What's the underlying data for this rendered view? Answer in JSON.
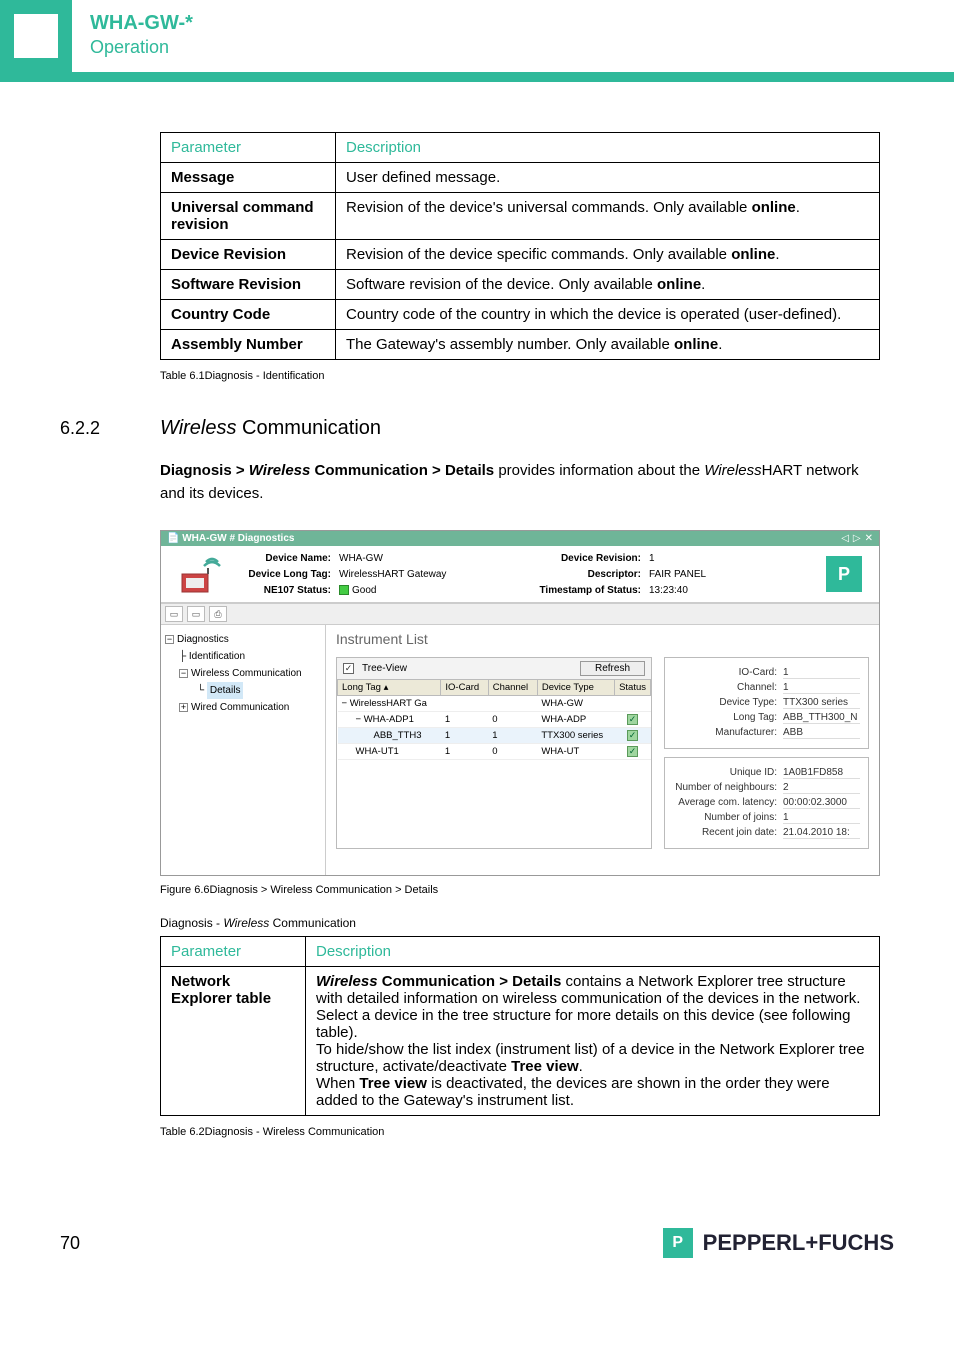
{
  "header": {
    "line1": "WHA-GW-*",
    "line2": "Operation"
  },
  "table1": {
    "head_param": "Parameter",
    "head_desc": "Description",
    "rows": [
      {
        "p": "Message",
        "d": "User defined message."
      },
      {
        "p": "Universal command revision",
        "d_pre": "Revision of the device's universal commands. Only available ",
        "d_bold": "online",
        "d_post": "."
      },
      {
        "p": "Device Revision",
        "d_pre": "Revision of the device specific commands. Only available ",
        "d_bold": "online",
        "d_post": "."
      },
      {
        "p": "Software Revision",
        "d_pre": "Software revision of the device. Only available ",
        "d_bold": "online",
        "d_post": "."
      },
      {
        "p": "Country Code",
        "d": "Country code of the country in which the device is operated (user-defined)."
      },
      {
        "p": "Assembly Number",
        "d_pre": "The Gateway's assembly number. Only available ",
        "d_bold": "online",
        "d_post": "."
      }
    ],
    "caption": "Table 6.1Diagnosis - Identification"
  },
  "section": {
    "num": "6.2.2",
    "title_it": "Wireless",
    "title_rest": " Communication",
    "body_b1": "Diagnosis > ",
    "body_bi": "Wireless",
    "body_b2": " Communication > Details",
    "body_r1": " provides information about the ",
    "body_i2": "Wireless",
    "body_r2": "HART network and its devices."
  },
  "screenshot": {
    "titlebar": "WHA-GW # Diagnostics",
    "hdr": {
      "device_name_lbl": "Device Name:",
      "device_name_val": "WHA-GW",
      "device_long_tag_lbl": "Device Long Tag:",
      "device_long_tag_val": "WirelessHART Gateway",
      "ne107_lbl": "NE107 Status:",
      "ne107_val": "Good",
      "device_rev_lbl": "Device Revision:",
      "device_rev_val": "1",
      "descriptor_lbl": "Descriptor:",
      "descriptor_val": "FAIR PANEL",
      "timestamp_lbl": "Timestamp of Status:",
      "timestamp_val": "13:23:40"
    },
    "tree": {
      "root": "Diagnostics",
      "n1": "Identification",
      "n2": "Wireless Communication",
      "n2a": "Details",
      "n3": "Wired Communication"
    },
    "main_title": "Instrument List",
    "treeview_label": "Tree-View",
    "refresh": "Refresh",
    "grid": {
      "h1": "Long Tag",
      "h2": "IO-Card",
      "h3": "Channel",
      "h4": "Device Type",
      "h5": "Status",
      "r0": {
        "tag": "WirelessHART Ga",
        "io": "",
        "ch": "",
        "dt": "WHA-GW",
        "st": ""
      },
      "r1": {
        "tag": "WHA-ADP1",
        "io": "1",
        "ch": "0",
        "dt": "WHA-ADP"
      },
      "r2": {
        "tag": "ABB_TTH3",
        "io": "1",
        "ch": "1",
        "dt": "TTX300 series"
      },
      "r3": {
        "tag": "WHA-UT1",
        "io": "1",
        "ch": "0",
        "dt": "WHA-UT"
      }
    },
    "side1": {
      "k1": "IO-Card:",
      "v1": "1",
      "k2": "Channel:",
      "v2": "1",
      "k3": "Device Type:",
      "v3": "TTX300 series",
      "k4": "Long Tag:",
      "v4": "ABB_TTH300_N",
      "k5": "Manufacturer:",
      "v5": "ABB"
    },
    "side2": {
      "k1": "Unique ID:",
      "v1": "1A0B1FD858",
      "k2": "Number of neighbours:",
      "v2": "2",
      "k3": "Average com. latency:",
      "v3": "00:00:02.3000",
      "k4": "Number of joins:",
      "v4": "1",
      "k5": "Recent join date:",
      "v5": "21.04.2010 18:"
    },
    "fig_caption": "Figure 6.6Diagnosis > Wireless Communication > Details"
  },
  "table2": {
    "title_pre": "Diagnosis - ",
    "title_it": "Wireless",
    "title_post": " Communication",
    "head_param": "Parameter",
    "head_desc": "Description",
    "row": {
      "p": "Network Explorer table",
      "d_bi1": "Wireless",
      "d_b1": " Communication > Details",
      "d_r1": " contains a Network Explorer tree structure with detailed information on wireless communication of the devices in the network. Select a device in the tree structure for more details on this device (see following table).",
      "d_r2a": "To hide/show the list index (instrument list) of a device in the Network Explorer tree structure, activate/deactivate ",
      "d_b2": "Tree view",
      "d_r2b": ".",
      "d_r3a": "When ",
      "d_b3": "Tree view",
      "d_r3b": " is deactivated, the devices are shown in the order they were added to the Gateway's instrument list."
    },
    "caption": "Table 6.2Diagnosis - Wireless Communication"
  },
  "footer": {
    "page": "70",
    "brand": "PEPPERL+FUCHS"
  }
}
